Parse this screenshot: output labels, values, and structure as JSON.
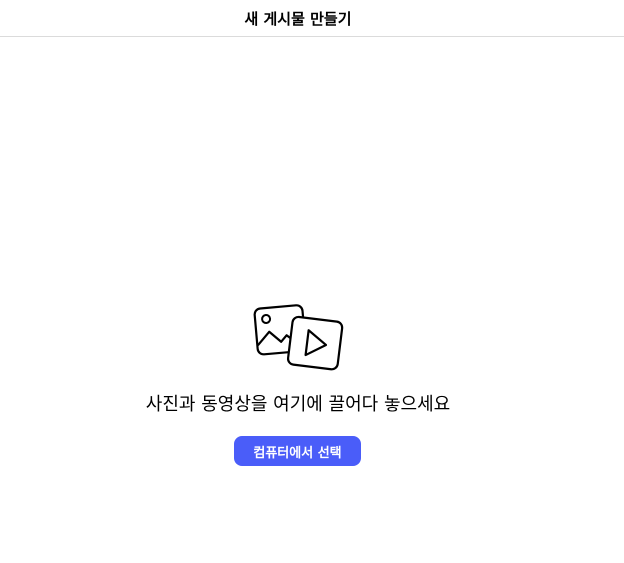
{
  "header": {
    "title": "새 게시물 만들기"
  },
  "dropzone": {
    "icon": "photo-video-icon",
    "instruction": "사진과 동영상을 여기에 끌어다 놓으세요",
    "select_button_label": "컴퓨터에서 선택"
  },
  "colors": {
    "accent": "#4a5df9",
    "divider": "#dbdbdb",
    "text": "#000000",
    "background": "#ffffff"
  }
}
